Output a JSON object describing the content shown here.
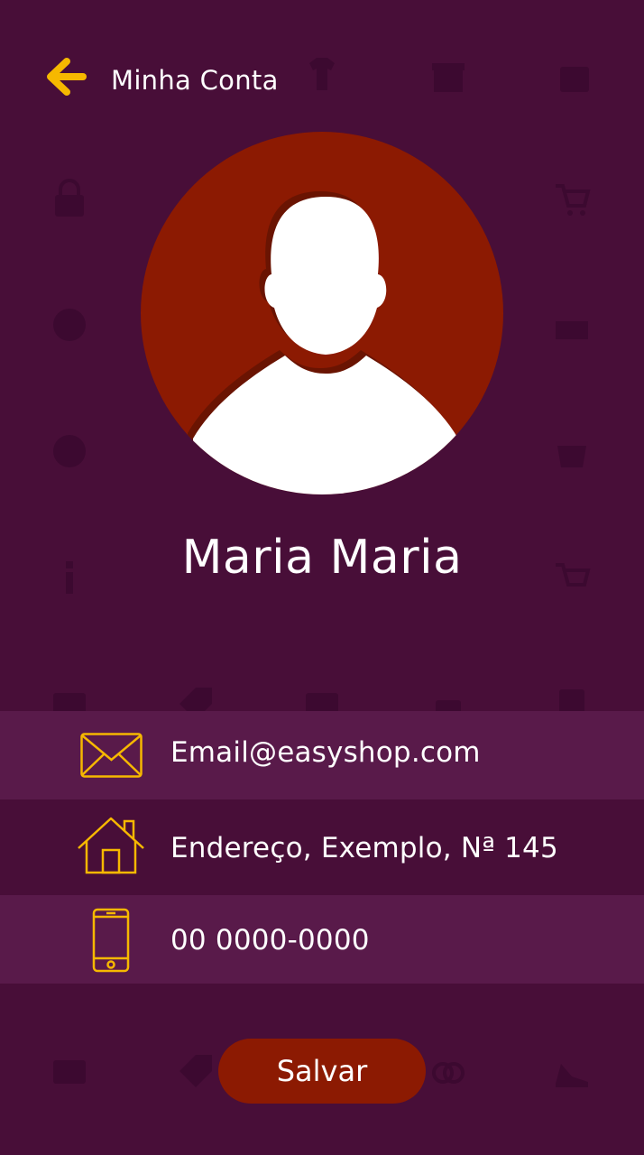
{
  "header": {
    "title": "Minha Conta",
    "back_icon": "arrow-left-icon"
  },
  "profile": {
    "name": "Maria Maria",
    "avatar_icon": "person-silhouette-icon"
  },
  "contact": {
    "email": {
      "icon": "envelope-icon",
      "value": "Email@easyshop.com"
    },
    "address": {
      "icon": "house-icon",
      "value": "Endereço, Exemplo, Nª 145"
    },
    "phone": {
      "icon": "smartphone-icon",
      "value": "00 0000-0000"
    }
  },
  "actions": {
    "save_label": "Salvar"
  },
  "colors": {
    "background": "#480e38",
    "row_highlight": "#591a4a",
    "accent": "#f6b800",
    "avatar_bg": "#8c1a02",
    "button_bg": "#8c1a02"
  }
}
